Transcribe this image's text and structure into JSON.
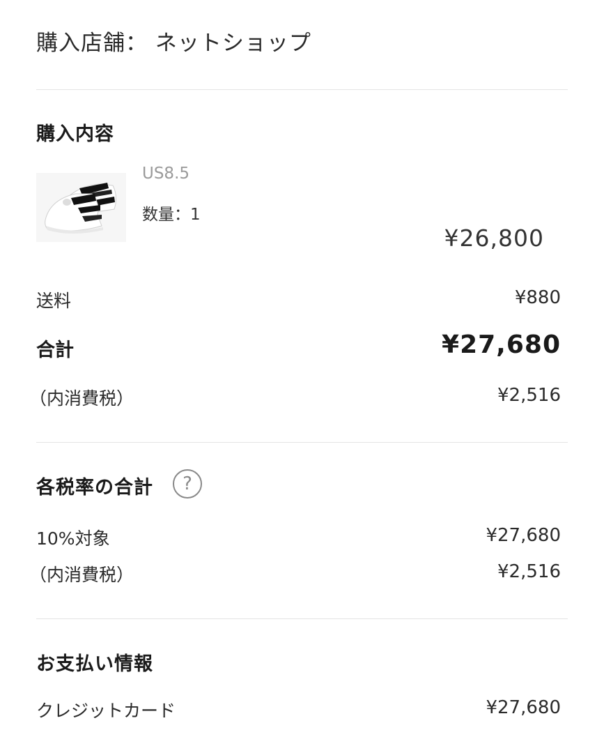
{
  "store": {
    "text": "購入店舗： ネットショップ"
  },
  "purchase": {
    "title": "購入内容",
    "item": {
      "variant": "US8.5",
      "quantity": "数量：1",
      "price": "¥26,800"
    },
    "shipping": {
      "label": "送料",
      "value": "¥880"
    },
    "total": {
      "label": "合計",
      "value": "¥27,680"
    },
    "tax": {
      "label": "（内消費税）",
      "value": "¥2,516"
    }
  },
  "tax_rates": {
    "title": "各税率の合計",
    "help_icon": "?",
    "rate_10": {
      "label": "10%対象",
      "value": "¥27,680"
    },
    "tax": {
      "label": "（内消費税）",
      "value": "¥2,516"
    }
  },
  "payment": {
    "title": "お支払い情報",
    "method": {
      "label": "クレジットカード",
      "value": "¥27,680"
    }
  }
}
